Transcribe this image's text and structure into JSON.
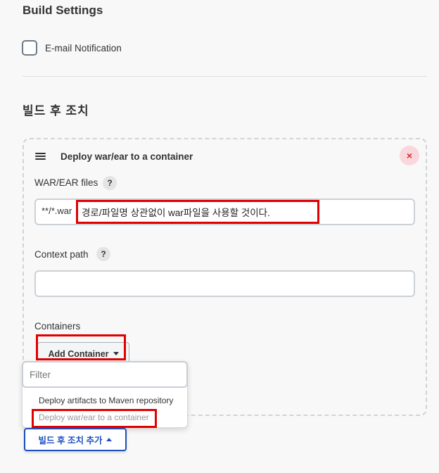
{
  "build_settings": {
    "heading": "Build Settings",
    "email_notification_label": "E-mail Notification",
    "email_notification_checked": false
  },
  "post_build": {
    "heading": "빌드 후 조치",
    "add_button_label": "빌드 후 조치 추가"
  },
  "deploy_card": {
    "title": "Deploy war/ear to a container",
    "war_files": {
      "label": "WAR/EAR files",
      "help": "?",
      "value": "**/*.war"
    },
    "context_path": {
      "label": "Context path",
      "help": "?",
      "value": ""
    },
    "containers": {
      "label": "Containers",
      "add_button_label": "Add Container"
    },
    "close": "×"
  },
  "dropdown": {
    "filter_placeholder": "Filter",
    "items": [
      {
        "label": "Deploy artifacts to Maven repository",
        "muted": false
      },
      {
        "label": "Deploy war/ear to a container",
        "muted": true
      }
    ]
  },
  "annotation": {
    "note": "경로/파일명 상관없이 war파일을 사용할 것이다.",
    "color": "#e00000"
  },
  "colors": {
    "accent": "#1c4fbf",
    "close_bg": "#f9d7dc",
    "close_fg": "#d0302f",
    "background": "#f8f8f8"
  }
}
